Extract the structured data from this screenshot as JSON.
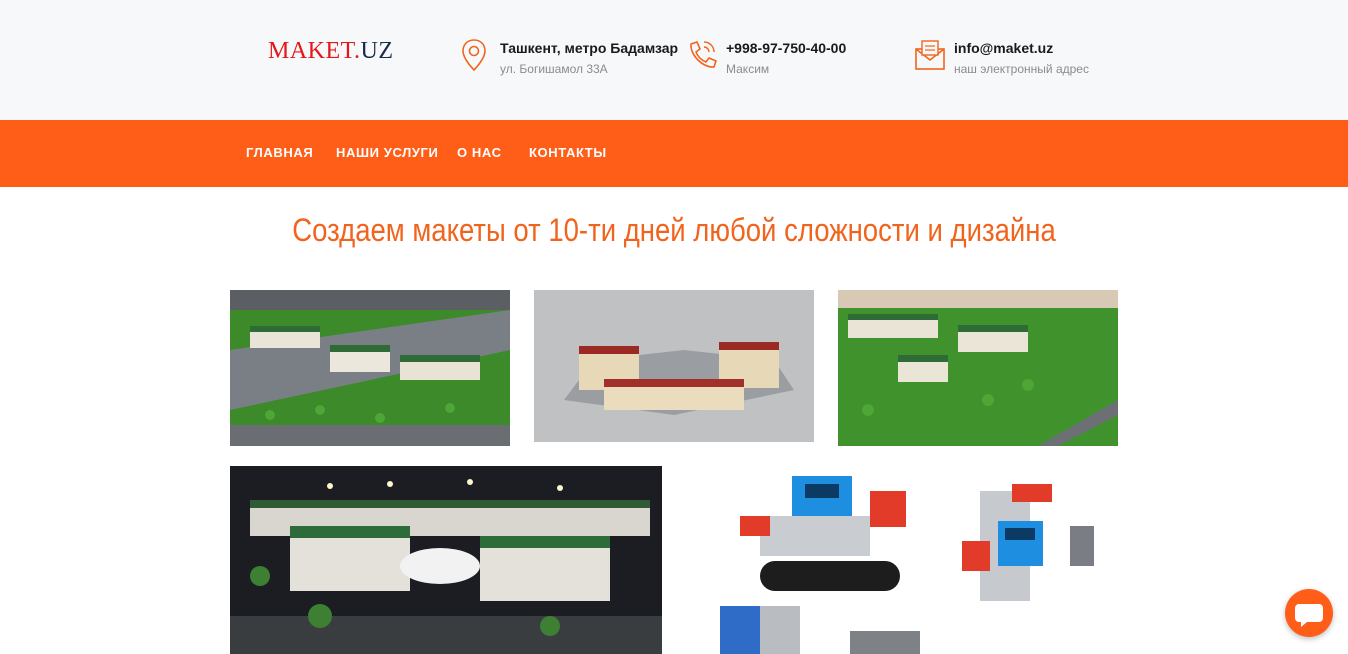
{
  "logo": {
    "part1": "MAKET.",
    "part2": "UZ"
  },
  "contacts": [
    {
      "icon": "location-pin-icon",
      "title": "Ташкент, метро Бадамзар",
      "subtitle": "ул. Богишамол 33А"
    },
    {
      "icon": "phone-icon",
      "title": "+998-97-750-40-00",
      "subtitle": "Максим"
    },
    {
      "icon": "mail-icon",
      "title": "info@maket.uz",
      "subtitle": "наш электронный адрес"
    }
  ],
  "nav": {
    "items": [
      "ГЛАВНАЯ",
      "НАШИ УСЛУГИ",
      "О НАС",
      "КОНТАКТЫ"
    ]
  },
  "hero": {
    "title": "Создаем макеты от 10-ти дней любой сложности и дизайна"
  },
  "colors": {
    "accent": "#ff5e19",
    "heading": "#f0641e",
    "logo_red": "#e4161a"
  },
  "gallery": [
    {
      "icon": "architectural-model-photo"
    },
    {
      "icon": "building-model-photo"
    },
    {
      "icon": "architectural-model-photo"
    },
    {
      "icon": "night-model-photo"
    },
    {
      "icon": "robot-kit-photo"
    }
  ],
  "chat": {
    "icon": "chat-bubble-icon"
  }
}
